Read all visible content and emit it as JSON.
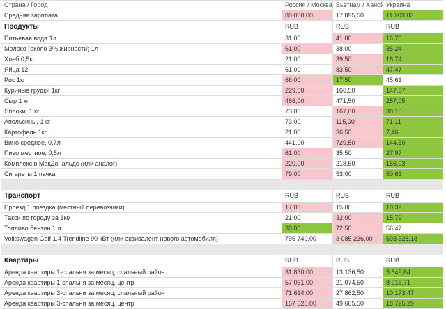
{
  "colors": {
    "expensive": "#f6c7cc",
    "cheapest": "#8ec63f",
    "separator": "#e7e7e7",
    "border": "#dcdcdc"
  },
  "header": {
    "label": "Страна / Город",
    "columns": [
      "Россия / Москва",
      "Вьетнам / Ханой",
      "Украина"
    ]
  },
  "salary": {
    "label": "Средняя зарплата",
    "values": [
      "80 000,00",
      "17 895,50",
      "11 203,03"
    ],
    "highlight": [
      "red",
      "",
      "green"
    ]
  },
  "sections": [
    {
      "title": "Продукты",
      "currency": [
        "RUB",
        "RUB",
        "RUB"
      ],
      "rows": [
        {
          "label": "Питьевая вода 1л",
          "values": [
            "31,00",
            "41,00",
            "16,76"
          ],
          "highlight": [
            "",
            "red",
            "green"
          ]
        },
        {
          "label": "Молоко (около 3% жирности) 1л",
          "values": [
            "61,00",
            "38,00",
            "35,24"
          ],
          "highlight": [
            "red",
            "",
            "green"
          ]
        },
        {
          "label": "Хлеб 0,5кг",
          "values": [
            "21,00",
            "39,50",
            "18,74"
          ],
          "highlight": [
            "",
            "red",
            "green"
          ]
        },
        {
          "label": "Яйца 12",
          "values": [
            "61,00",
            "83,50",
            "47,47"
          ],
          "highlight": [
            "",
            "red",
            "green"
          ]
        },
        {
          "label": "Рис 1кг",
          "values": [
            "66,00",
            "17,50",
            "45,61"
          ],
          "highlight": [
            "red",
            "green",
            ""
          ]
        },
        {
          "label": "Куриные грудки 1кг",
          "values": [
            "229,00",
            "166,50",
            "147,37"
          ],
          "highlight": [
            "red",
            "",
            "green"
          ]
        },
        {
          "label": "Сыр 1 кг",
          "values": [
            "486,00",
            "471,50",
            "257,05"
          ],
          "highlight": [
            "red",
            "",
            "green"
          ]
        },
        {
          "label": "Яблоки, 1 кг",
          "values": [
            "73,00",
            "167,00",
            "38,16"
          ],
          "highlight": [
            "",
            "red",
            "green"
          ]
        },
        {
          "label": "Апельсины, 1 кг",
          "values": [
            "73,00",
            "115,00",
            "71,11"
          ],
          "highlight": [
            "",
            "red",
            "green"
          ]
        },
        {
          "label": "Картофель 1кг",
          "values": [
            "21,00",
            "36,50",
            "7,46"
          ],
          "highlight": [
            "",
            "red",
            "green"
          ]
        },
        {
          "label": "Вино среднее, 0,7л",
          "values": [
            "441,00",
            "729,50",
            "144,50"
          ],
          "highlight": [
            "",
            "red",
            "green"
          ]
        },
        {
          "label": "Пиво местное, 0,5л",
          "values": [
            "61,00",
            "35,50",
            "27,97"
          ],
          "highlight": [
            "red",
            "",
            "green"
          ]
        },
        {
          "label": "Комплекс в МакДональдс (или аналог)",
          "values": [
            "220,00",
            "218,50",
            "156,03"
          ],
          "highlight": [
            "red",
            "",
            "green"
          ]
        },
        {
          "label": "Сигареты 1 пачка",
          "values": [
            "79,00",
            "53,00",
            "50,63"
          ],
          "highlight": [
            "red",
            "",
            "green"
          ]
        }
      ]
    },
    {
      "title": "Транспорт",
      "currency": [
        "RUB",
        "RUB",
        "RUB"
      ],
      "rows": [
        {
          "label": "Проезд 1 поездка (местный перевозчики)",
          "values": [
            "17,00",
            "15,00",
            "10,39"
          ],
          "highlight": [
            "red",
            "",
            "green"
          ]
        },
        {
          "label": "Такси по городу за 1км",
          "values": [
            "21,00",
            "32,00",
            "15,79"
          ],
          "highlight": [
            "",
            "red",
            "green"
          ]
        },
        {
          "label": "Топливо бензин 1 л",
          "values": [
            "33,00",
            "72,50",
            "56,47"
          ],
          "highlight": [
            "green",
            "red",
            ""
          ]
        },
        {
          "label": "Volkswagen Golf 1.4 Trendline 90 кВт (или эквивалент нового автомобиля)",
          "values": [
            "795 740,00",
            "3 085 236,00",
            "593 328,18"
          ],
          "highlight": [
            "",
            "red",
            "green"
          ]
        }
      ]
    },
    {
      "title": "Квартиры",
      "currency": [
        "RUB",
        "RUB",
        "RUB"
      ],
      "rows": [
        {
          "label": "Аренда квартиры 1-спальня за месяц, спальный район",
          "values": [
            "31 830,00",
            "13 136,50",
            "5 549,84"
          ],
          "highlight": [
            "red",
            "",
            "green"
          ]
        },
        {
          "label": "Аренда квартиры 1-спальня за месяц, центр",
          "values": [
            "57 061,00",
            "21 074,50",
            "8 916,71"
          ],
          "highlight": [
            "red",
            "",
            "green"
          ]
        },
        {
          "label": "Аренда квартиры 3-спальни за месяц, спальный район",
          "values": [
            "71 614,00",
            "27 862,50",
            "10 173,47"
          ],
          "highlight": [
            "red",
            "",
            "green"
          ]
        },
        {
          "label": "Аренда квартиры 3-спальни за месяц, центр",
          "values": [
            "157 520,00",
            "49 605,50",
            "18 725,29"
          ],
          "highlight": [
            "red",
            "",
            "green"
          ]
        }
      ]
    }
  ]
}
